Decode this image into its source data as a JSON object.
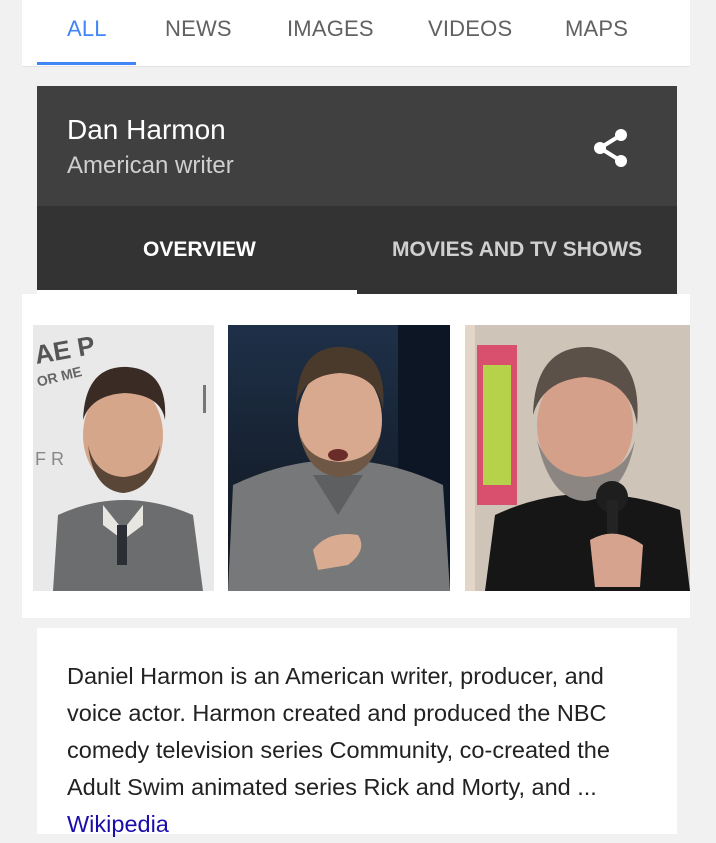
{
  "search_tabs": [
    {
      "label": "ALL",
      "active": true
    },
    {
      "label": "NEWS",
      "active": false
    },
    {
      "label": "IMAGES",
      "active": false
    },
    {
      "label": "VIDEOS",
      "active": false
    },
    {
      "label": "MAPS",
      "active": false
    }
  ],
  "knowledge_panel": {
    "title": "Dan Harmon",
    "subtitle": "American writer",
    "share_icon": "share-icon",
    "tabs": [
      {
        "label": "OVERVIEW",
        "active": true
      },
      {
        "label": "MOVIES AND TV SHOWS",
        "active": false
      }
    ]
  },
  "photos": [
    {
      "description": "photo-1"
    },
    {
      "description": "photo-2"
    },
    {
      "description": "photo-3"
    }
  ],
  "description": {
    "text": "Daniel Harmon is an American writer, producer, and voice actor. Harmon created and produced the NBC comedy television series Community, co-created the Adult Swim animated series Rick and Morty, and ... ",
    "source_link": "Wikipedia"
  },
  "colors": {
    "accent": "#4285f4",
    "header_bg": "#404040",
    "tabs_bg": "#333333",
    "link": "#1a0dab"
  }
}
